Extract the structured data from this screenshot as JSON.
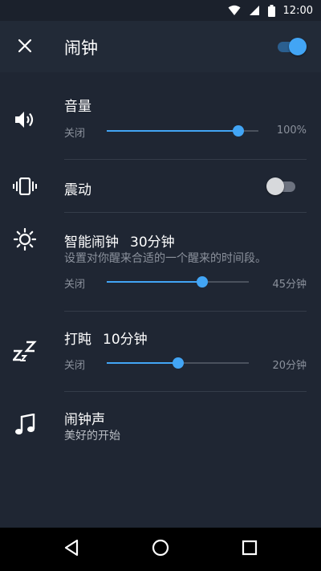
{
  "status_bar": {
    "time": "12:00"
  },
  "header": {
    "title": "闹钟",
    "alarm_enabled": true
  },
  "settings": {
    "volume": {
      "title": "音量",
      "min_label": "关闭",
      "max_label": "100%",
      "level": 0.87
    },
    "vibrate": {
      "title": "震动",
      "enabled": false
    },
    "smart_alarm": {
      "title": "智能闹钟",
      "value": "30分钟",
      "description": "设置对你醒来合适的一个醒来的时间段。",
      "min_label": "关闭",
      "max_label": "45分钟",
      "level": 0.67
    },
    "snooze": {
      "title": "打盹",
      "value": "10分钟",
      "min_label": "关闭",
      "max_label": "20分钟",
      "level": 0.5
    },
    "ringtone": {
      "title": "闹钟声",
      "value": "美好的开始"
    }
  },
  "colors": {
    "background": "#1f2633",
    "accent": "#42a5f5",
    "secondary_text": "#8b919c"
  }
}
